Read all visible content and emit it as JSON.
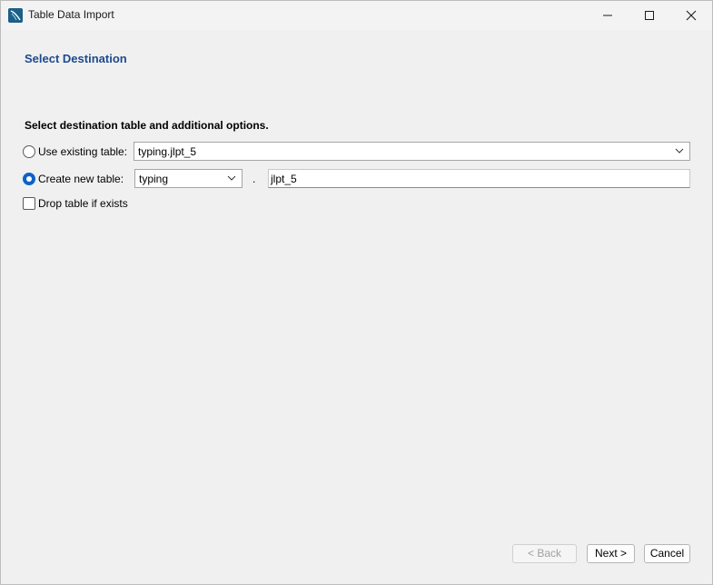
{
  "window": {
    "title": "Table Data Import"
  },
  "page": {
    "heading": "Select Destination",
    "instructions": "Select destination table and additional options."
  },
  "options": {
    "use_existing": {
      "label": "Use existing table:",
      "selected": false,
      "value": "typing.jlpt_5"
    },
    "create_new": {
      "label": "Create new table:",
      "selected": true,
      "schema_value": "typing",
      "separator": ".",
      "table_name_value": "jlpt_5"
    },
    "drop_table": {
      "label": "Drop table if exists",
      "checked": false
    }
  },
  "buttons": {
    "back": "< Back",
    "next": "Next >",
    "cancel": "Cancel"
  },
  "colors": {
    "heading": "#1e4a8c",
    "radio_selected": "#0f62c6",
    "background": "#f0f0f0"
  }
}
